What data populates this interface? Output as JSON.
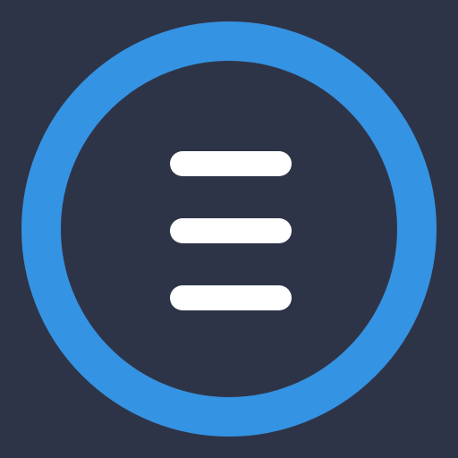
{
  "app_icon": {
    "icon": "hamburger-menu-icon",
    "background_color": "#2e3447",
    "ring_color": "#3593e3",
    "bars_color": "#ffffff",
    "bar_count": 3
  }
}
